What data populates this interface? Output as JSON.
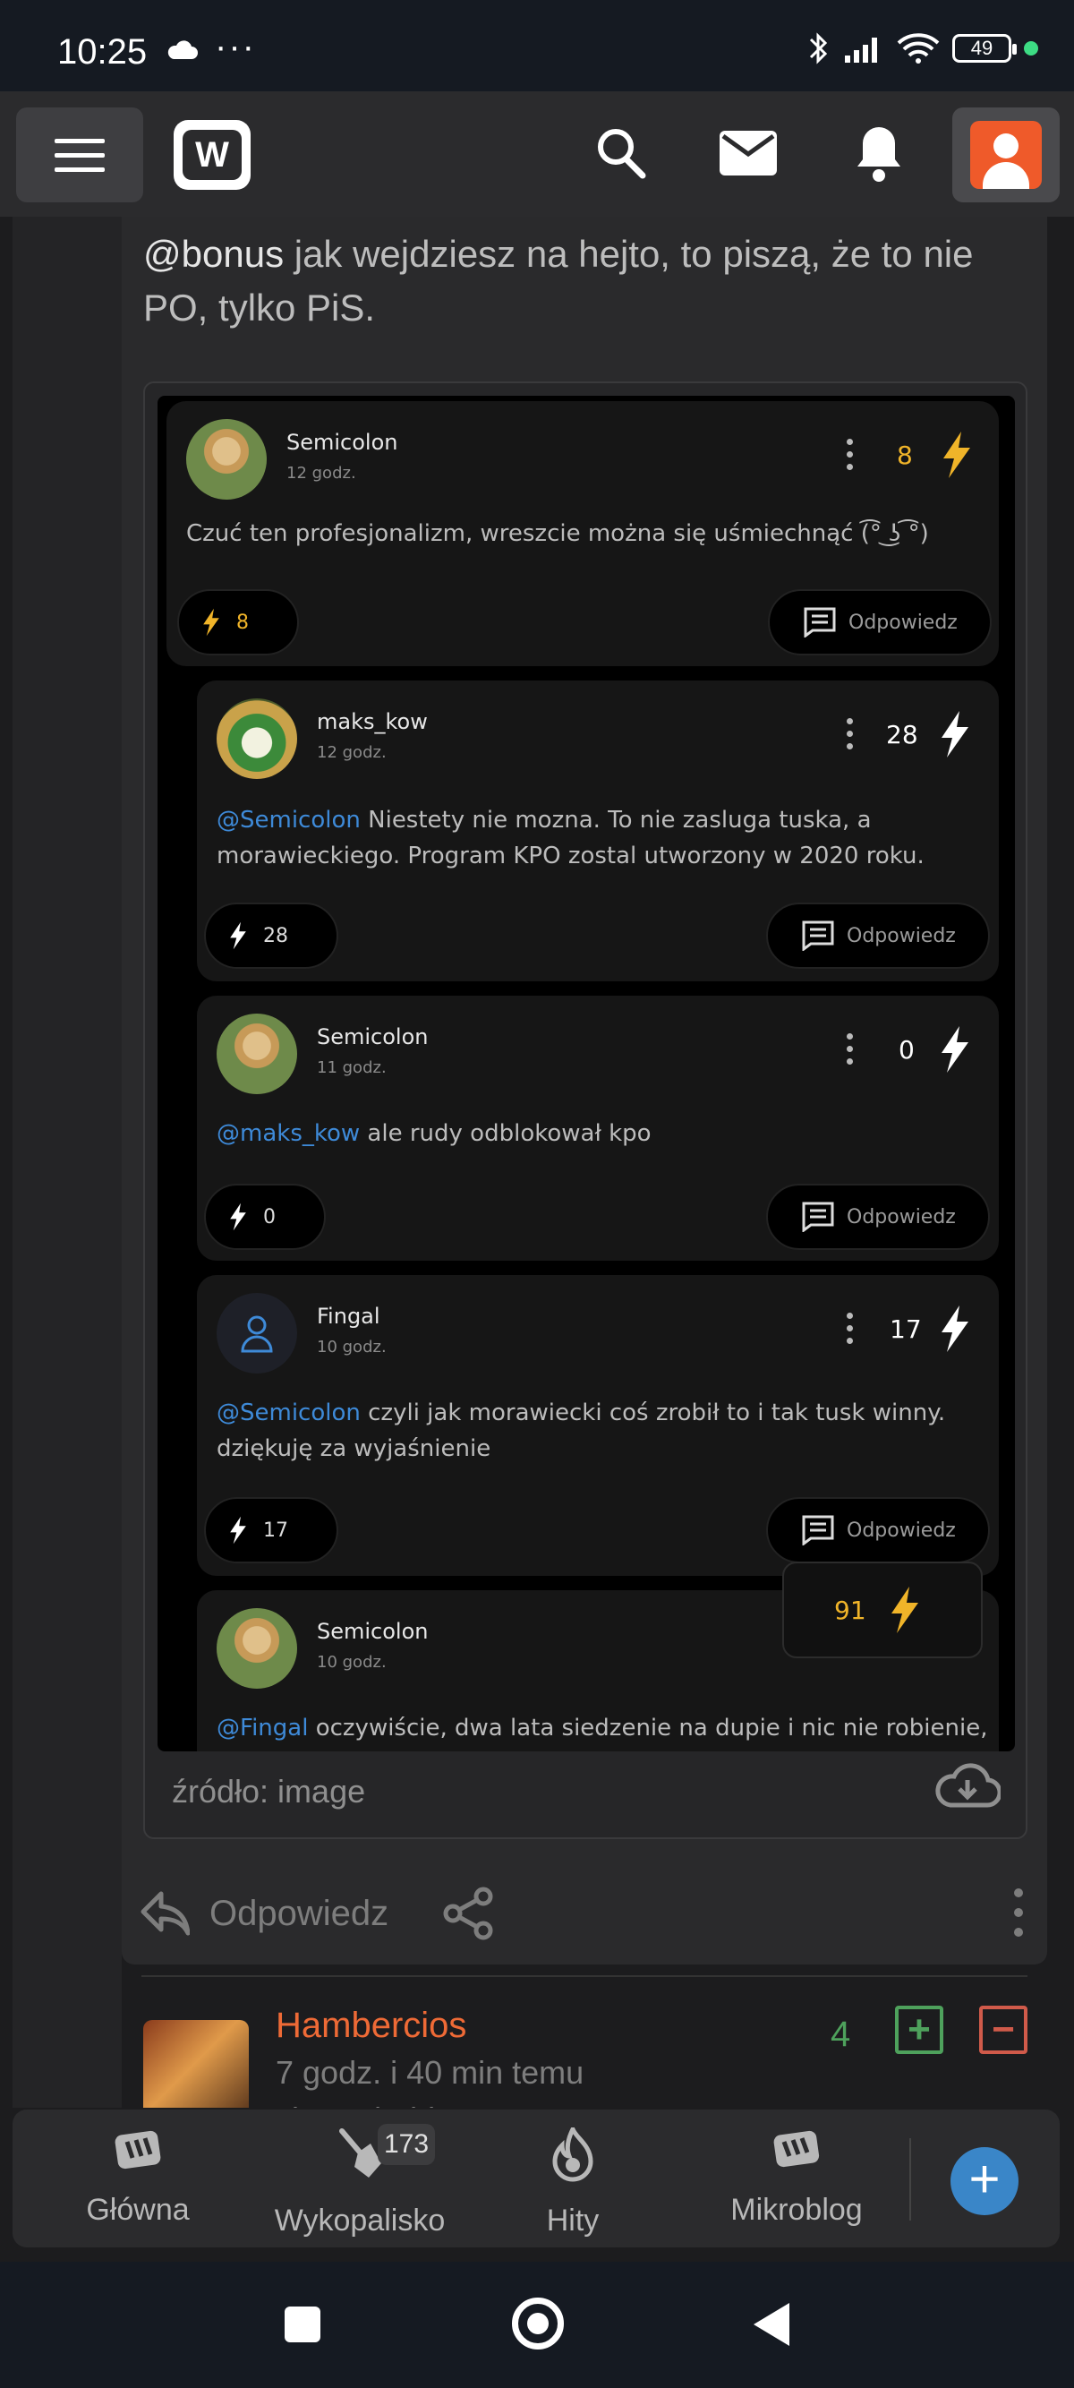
{
  "status_bar": {
    "time": "10:25",
    "overflow": "···",
    "battery": "49"
  },
  "top_bar": {
    "logo": "W"
  },
  "comment": {
    "mention": "@bonus",
    "text": " jak wejdziesz na hejto, to piszą, że to nie PO, tylko PiS.",
    "source": "źródło: image",
    "reply_label": "Odpowiedz"
  },
  "embedded_screenshot": {
    "reply_label": "Odpowiedz",
    "tooltip_points": "91",
    "comments": [
      {
        "author": "Semicolon",
        "time": "12 godz.",
        "points": "8",
        "mention": "",
        "text": "Czuć ten profesjonalizm, wreszcie można się uśmiechnąć (͡° ͜ʖ ͡°)",
        "text2": ""
      },
      {
        "author": "maks_kow",
        "time": "12 godz.",
        "points": "28",
        "mention": "@Semicolon",
        "text": " Niestety nie mozna. To nie zasluga tuska, a",
        "text2": "morawieckiego. Program KPO zostal utworzony w 2020 roku."
      },
      {
        "author": "Semicolon",
        "time": "11 godz.",
        "points": "0",
        "mention": "@maks_kow",
        "text": " ale rudy odblokował kpo",
        "text2": ""
      },
      {
        "author": "Fingal",
        "time": "10 godz.",
        "points": "17",
        "mention": "@Semicolon",
        "text": " czyli jak morawiecki coś zrobił to i tak tusk winny.",
        "text2": "dziękuję za wyjaśnienie"
      },
      {
        "author": "Semicolon",
        "time": "10 godz.",
        "points": "",
        "mention": "@Fingal",
        "text": " oczywiście, dwa lata siedzenie na dupie i nic nie robienie,",
        "text2": ""
      }
    ]
  },
  "next_entry": {
    "author": "Hambercios",
    "time": "7 godz. i 40 min temu",
    "via": "via Android",
    "votes": "4",
    "plus": "+",
    "minus": "−"
  },
  "bottom_nav": {
    "items": [
      {
        "label": "Główna"
      },
      {
        "label": "Wykopalisko",
        "badge": "173"
      },
      {
        "label": "Hity"
      },
      {
        "label": "Mikroblog"
      }
    ],
    "fab": "+"
  },
  "colors": {
    "accent_orange": "#ee6a36",
    "link_blue": "#3e8ad8",
    "bolt_yellow": "#f0b429",
    "vote_green": "#4ea15c",
    "vote_red": "#d05a4a"
  }
}
